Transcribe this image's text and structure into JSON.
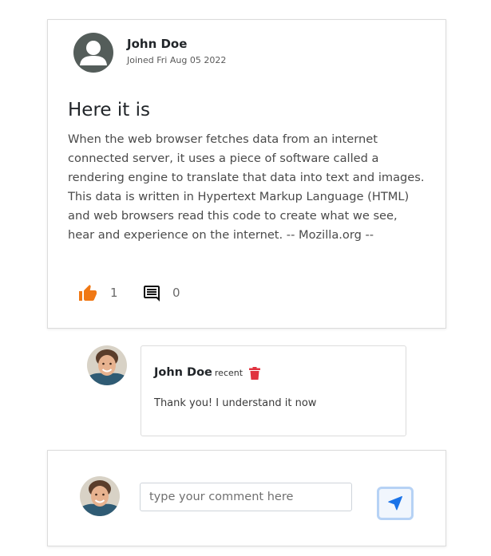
{
  "post": {
    "author_name": "John Doe",
    "joined": "Joined Fri Aug 05 2022",
    "title": "Here it is",
    "body": "When the web browser fetches data from an internet connected server, it uses a piece of software called a rendering engine to translate that data into text and images. This data is written in Hypertext Markup Language (HTML) and web browsers read this code to create what we see, hear and experience on the internet. -- Mozilla.org --",
    "like_count": "1",
    "comment_count": "0"
  },
  "comment": {
    "author_name": "John Doe",
    "time": "recent",
    "text": "Thank you! I understand it now"
  },
  "composer": {
    "placeholder": "type your comment here"
  },
  "colors": {
    "like_icon": "#f07814",
    "delete_icon": "#e0333f",
    "send_icon": "#1a73e8",
    "default_avatar_bg": "#545d5a"
  }
}
